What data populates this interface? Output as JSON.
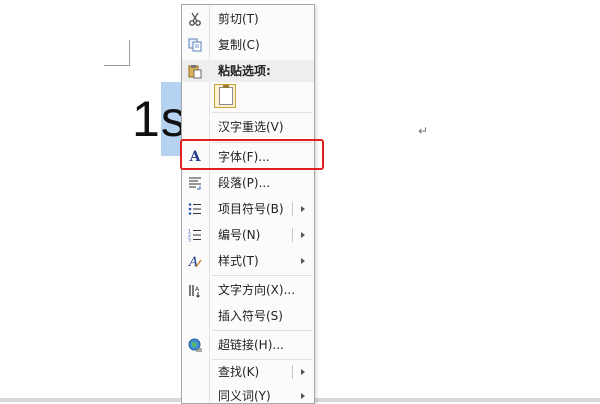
{
  "document": {
    "text_before": "1",
    "text_selected": "s",
    "paragraph_mark": "↵"
  },
  "context_menu": {
    "items": [
      {
        "name": "cut",
        "label": "剪切(T)",
        "icon": "scissors-icon"
      },
      {
        "name": "copy",
        "label": "复制(C)",
        "icon": "copy-icon"
      },
      {
        "name": "paste-options",
        "label": "粘贴选项:",
        "icon": "paste-icon"
      },
      {
        "name": "reconvert",
        "label": "汉字重选(V)"
      },
      {
        "name": "font",
        "label": "字体(F)...",
        "icon": "font-a-icon"
      },
      {
        "name": "paragraph",
        "label": "段落(P)...",
        "icon": "paragraph-icon"
      },
      {
        "name": "bullets",
        "label": "项目符号(B)",
        "icon": "bullet-list-icon",
        "submenu": true
      },
      {
        "name": "numbering",
        "label": "编号(N)",
        "icon": "numbered-list-icon",
        "submenu": true
      },
      {
        "name": "styles",
        "label": "样式(T)",
        "icon": "styles-icon",
        "submenu": true
      },
      {
        "name": "text-direction",
        "label": "文字方向(X)...",
        "icon": "text-direction-icon"
      },
      {
        "name": "insert-symbol",
        "label": "插入符号(S)"
      },
      {
        "name": "hyperlink",
        "label": "超链接(H)...",
        "icon": "hyperlink-globe-icon"
      },
      {
        "name": "lookup",
        "label": "查找(K)",
        "submenu": true
      },
      {
        "name": "synonyms",
        "label": "同义词(Y)",
        "submenu": true
      }
    ]
  },
  "colors": {
    "selection": "#b5d2f0",
    "highlight_border": "#e02020",
    "font_icon": "#1f3a8a"
  }
}
